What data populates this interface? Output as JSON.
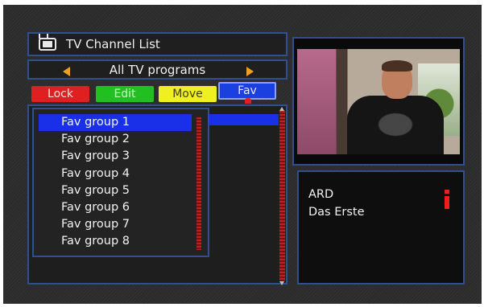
{
  "header": {
    "title": "TV Channel List",
    "icon": "tv-icon"
  },
  "group_selector": {
    "label": "All TV programs"
  },
  "buttons": {
    "lock": "Lock",
    "edit": "Edit",
    "move": "Move",
    "fav": "Fav"
  },
  "fav_groups": [
    "Fav group 1",
    "Fav group 2",
    "Fav group 3",
    "Fav group 4",
    "Fav group 5",
    "Fav group 6",
    "Fav group 7",
    "Fav group 8"
  ],
  "selected_group_index": 0,
  "info": {
    "channel": "ARD",
    "program": "Das Erste"
  },
  "colors": {
    "red": "#e02020",
    "green": "#20c020",
    "yellow": "#f0f020",
    "blue": "#1a40e0",
    "accent": "#f0a020"
  }
}
